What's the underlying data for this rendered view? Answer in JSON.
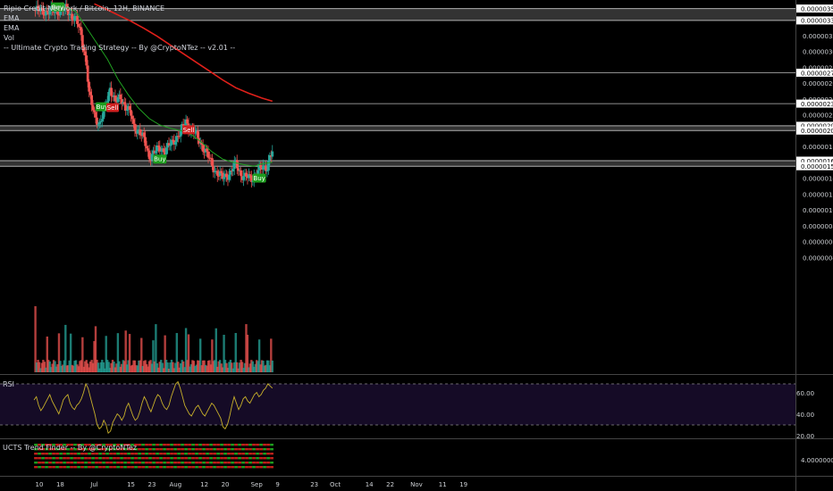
{
  "legend": {
    "title": "Ripio Credit Network / Bitcoin, 12H, BINANCE",
    "ema1": "EMA",
    "ema2": "EMA",
    "vol": "Vol",
    "strategy": "-- Ultimate Crypto Trading Strategy -- By @CryptoNTez -- v2.01 --"
  },
  "rsi_panel": {
    "label": "RSI",
    "ticks": [
      "60.00",
      "40.00",
      "20.00"
    ]
  },
  "trend_panel": {
    "label": "UCTS Trend Finder -- By @CryptoNTez",
    "tick": "4.00000000"
  },
  "colors": {
    "up": "#26a69a",
    "down": "#ef5350",
    "ema_fast": "#21a121",
    "ema_slow": "#e0201a",
    "rsi": "#c8b02a",
    "buy": "#1e9e1e",
    "sell": "#d02020"
  },
  "chart_data": {
    "type": "candlestick",
    "title": "Ripio Credit Network / Bitcoin, 12H, BINANCE",
    "y_axis_ticks": [
      "0.00000340",
      "0.00000320",
      "0.00000300",
      "0.00000280",
      "0.00000260",
      "0.00000240",
      "0.00000220",
      "0.00000200",
      "0.00000180",
      "0.00000160",
      "0.00000140",
      "0.00000120",
      "0.00000100",
      "0.00000080",
      "0.00000060",
      "0.00000040"
    ],
    "price_tags": [
      "0.00000354",
      "0.00000339",
      "0.00000273",
      "0.00000234",
      "0.00000206",
      "0.00000200",
      "0.00000162",
      "0.00000155"
    ],
    "x_axis_labels": [
      "10",
      "18",
      "Jul",
      "15",
      "23",
      "Aug",
      "12",
      "20",
      "Sep",
      "9",
      "23",
      "Oct",
      "14",
      "22",
      "Nov",
      "11",
      "19"
    ],
    "x_axis_dates": [
      "2018-06-10",
      "2018-06-18",
      "2018-07-01",
      "2018-07-15",
      "2018-07-23",
      "2018-08-01",
      "2018-08-12",
      "2018-08-20",
      "2018-09-01",
      "2018-09-09",
      "2018-09-23",
      "2018-10-01",
      "2018-10-14",
      "2018-10-22",
      "2018-11-01",
      "2018-11-11",
      "2018-11-19"
    ],
    "support_resistance": [
      {
        "name": "zone-354-339",
        "from": 339,
        "to": 354
      },
      {
        "name": "line-273",
        "level": 273
      },
      {
        "name": "line-234",
        "level": 234
      },
      {
        "name": "zone-206-200",
        "from": 200,
        "to": 206
      },
      {
        "name": "zone-162-155",
        "from": 155,
        "to": 162
      }
    ],
    "close_anchors": [
      [
        "2018-06-08",
        352
      ],
      [
        "2018-06-14",
        350
      ],
      [
        "2018-06-20",
        353
      ],
      [
        "2018-06-24",
        340
      ],
      [
        "2018-06-26",
        320
      ],
      [
        "2018-06-28",
        285
      ],
      [
        "2018-06-29",
        245
      ],
      [
        "2018-07-01",
        220
      ],
      [
        "2018-07-03",
        208
      ],
      [
        "2018-07-05",
        225
      ],
      [
        "2018-07-07",
        255
      ],
      [
        "2018-07-09",
        235
      ],
      [
        "2018-07-11",
        242
      ],
      [
        "2018-07-13",
        230
      ],
      [
        "2018-07-15",
        220
      ],
      [
        "2018-07-16",
        205
      ],
      [
        "2018-07-18",
        200
      ],
      [
        "2018-07-20",
        188
      ],
      [
        "2018-07-22",
        168
      ],
      [
        "2018-07-24",
        172
      ],
      [
        "2018-07-26",
        178
      ],
      [
        "2018-07-28",
        175
      ],
      [
        "2018-07-30",
        182
      ],
      [
        "2018-08-01",
        190
      ],
      [
        "2018-08-03",
        198
      ],
      [
        "2018-08-05",
        212
      ],
      [
        "2018-08-06",
        205
      ],
      [
        "2018-08-08",
        198
      ],
      [
        "2018-08-10",
        188
      ],
      [
        "2018-08-13",
        170
      ],
      [
        "2018-08-16",
        150
      ],
      [
        "2018-08-19",
        140
      ],
      [
        "2018-08-22",
        147
      ],
      [
        "2018-08-24",
        158
      ],
      [
        "2018-08-26",
        145
      ],
      [
        "2018-08-28",
        141
      ],
      [
        "2018-08-30",
        139
      ],
      [
        "2018-09-01",
        148
      ],
      [
        "2018-09-03",
        152
      ],
      [
        "2018-09-05",
        155
      ],
      [
        "2018-09-06",
        168
      ],
      [
        "2018-09-07",
        172
      ]
    ],
    "ema_fast": [
      [
        "2018-06-20",
        356
      ],
      [
        "2018-06-24",
        350
      ],
      [
        "2018-06-28",
        330
      ],
      [
        "2018-07-02",
        310
      ],
      [
        "2018-07-06",
        290
      ],
      [
        "2018-07-10",
        265
      ],
      [
        "2018-07-14",
        245
      ],
      [
        "2018-07-18",
        228
      ],
      [
        "2018-07-22",
        215
      ],
      [
        "2018-07-26",
        207
      ],
      [
        "2018-07-30",
        203
      ],
      [
        "2018-08-03",
        200
      ],
      [
        "2018-08-07",
        195
      ],
      [
        "2018-08-11",
        185
      ],
      [
        "2018-08-15",
        173
      ],
      [
        "2018-08-19",
        164
      ],
      [
        "2018-08-23",
        160
      ],
      [
        "2018-08-27",
        157
      ],
      [
        "2018-08-31",
        155
      ],
      [
        "2018-09-03",
        158
      ],
      [
        "2018-09-07",
        160
      ]
    ],
    "ema_slow": [
      [
        "2018-07-01",
        360
      ],
      [
        "2018-07-05",
        354
      ],
      [
        "2018-07-10",
        346
      ],
      [
        "2018-07-15",
        338
      ],
      [
        "2018-07-20",
        329
      ],
      [
        "2018-07-25",
        319
      ],
      [
        "2018-07-30",
        308
      ],
      [
        "2018-08-04",
        297
      ],
      [
        "2018-08-09",
        286
      ],
      [
        "2018-08-14",
        275
      ],
      [
        "2018-08-19",
        264
      ],
      [
        "2018-08-24",
        254
      ],
      [
        "2018-08-29",
        247
      ],
      [
        "2018-09-03",
        241
      ],
      [
        "2018-09-07",
        237
      ]
    ],
    "rsi": {
      "ticks": [
        60,
        40,
        20
      ],
      "bands": [
        70,
        30
      ],
      "values": [
        55,
        58,
        50,
        45,
        48,
        52,
        56,
        60,
        54,
        50,
        46,
        42,
        48,
        55,
        58,
        60,
        52,
        48,
        46,
        50,
        52,
        56,
        62,
        70,
        66,
        58,
        50,
        42,
        32,
        28,
        30,
        36,
        32,
        24,
        26,
        34,
        38,
        42,
        40,
        36,
        40,
        48,
        52,
        46,
        40,
        36,
        38,
        44,
        52,
        58,
        54,
        48,
        44,
        50,
        56,
        60,
        58,
        52,
        48,
        46,
        50,
        58,
        64,
        70,
        72,
        66,
        58,
        50,
        46,
        42,
        40,
        44,
        48,
        50,
        46,
        42,
        40,
        44,
        48,
        52,
        50,
        46,
        42,
        38,
        30,
        28,
        32,
        40,
        50,
        58,
        52,
        46,
        50,
        56,
        58,
        54,
        52,
        56,
        60,
        62,
        58,
        60,
        64,
        66,
        70,
        68,
        66
      ]
    },
    "signals": [
      {
        "label": "Buy",
        "date": "2018-06-17",
        "price": 356
      },
      {
        "label": "Buy",
        "date": "2018-07-04",
        "price": 230
      },
      {
        "label": "Sell",
        "date": "2018-07-08",
        "price": 229
      },
      {
        "label": "Buy",
        "date": "2018-07-26",
        "price": 164
      },
      {
        "label": "Sell",
        "date": "2018-08-06",
        "price": 201
      },
      {
        "label": "Buy",
        "date": "2018-09-02",
        "price": 140
      }
    ]
  }
}
